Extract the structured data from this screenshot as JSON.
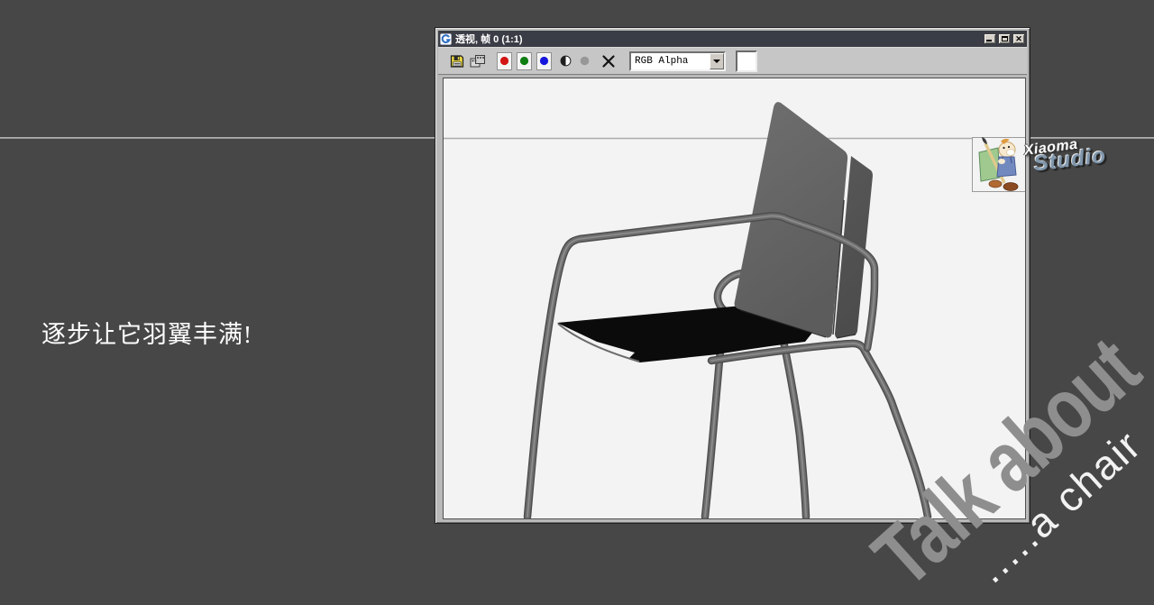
{
  "page": {
    "caption": "逐步让它羽翼丰满!"
  },
  "watermark": {
    "primary": "Talk about",
    "secondary": ".....a chair",
    "primary_color": "#8e8e8e",
    "secondary_color": "#f2f2f2"
  },
  "logo": {
    "name_top": "Xiaoma",
    "name_bottom": "Studio",
    "name_bottom_color": "#7f96ac",
    "mascot": "xiaoma-painter-mascot"
  },
  "window": {
    "title": "透视, 帧 0 (1:1)",
    "title_icon": "vfb-g-icon",
    "controls": {
      "minimize": "minimize",
      "maximize": "maximize",
      "close_glyph": "✕"
    },
    "toolbar": {
      "save_icon": "save-bitmap-floppy",
      "clone_icon": "clone-rendered-frame",
      "channels": [
        {
          "name": "red-channel",
          "color": "#d21414"
        },
        {
          "name": "green-channel",
          "color": "#0e7d12"
        },
        {
          "name": "blue-channel",
          "color": "#1616dc"
        }
      ],
      "alpha_icon": "alpha-channel",
      "mono_icon": "monochrome-channel",
      "clear_icon": "clear-frame",
      "dropdown_value": "RGB Alpha",
      "swatch_color": "#ffffff"
    }
  },
  "render": {
    "subject": "gray 3d chair model render",
    "background": "#f3f3f3"
  },
  "colors": {
    "page_background": "#474747",
    "divider": "#a9a9a9",
    "titlebar": "#3b3d46"
  }
}
